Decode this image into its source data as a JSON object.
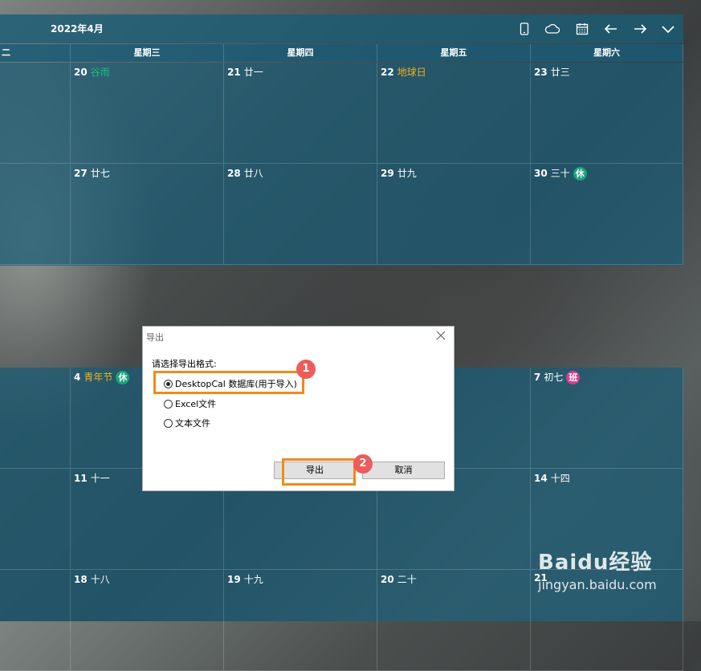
{
  "header": {
    "title": "2022年4月"
  },
  "weekdays": [
    "二",
    "星期三",
    "星期四",
    "星期五",
    "星期六"
  ],
  "top_rows": [
    [
      {
        "day": "",
        "lunar": "",
        "lunar_color": ""
      },
      {
        "day": "20",
        "lunar": "谷雨",
        "lunar_color": "green"
      },
      {
        "day": "21",
        "lunar": "廿一",
        "lunar_color": ""
      },
      {
        "day": "22",
        "lunar": "地球日",
        "lunar_color": "orange"
      },
      {
        "day": "23",
        "lunar": "廿三",
        "lunar_color": ""
      }
    ],
    [
      {
        "day": "",
        "lunar": "",
        "lunar_color": ""
      },
      {
        "day": "27",
        "lunar": "廿七",
        "lunar_color": ""
      },
      {
        "day": "28",
        "lunar": "廿八",
        "lunar_color": ""
      },
      {
        "day": "29",
        "lunar": "廿九",
        "lunar_color": ""
      },
      {
        "day": "30",
        "lunar": "三十",
        "lunar_color": "",
        "badge": "休",
        "badge_type": "rest"
      }
    ]
  ],
  "bottom_rows": [
    [
      {
        "day": "",
        "lunar": "",
        "lunar_color": ""
      },
      {
        "day": "4",
        "lunar": "青年节",
        "lunar_color": "orange",
        "badge": "休",
        "badge_type": "rest"
      },
      {
        "day": "",
        "lunar": "",
        "lunar_color": ""
      },
      {
        "day": "",
        "lunar": "",
        "lunar_color": ""
      },
      {
        "day": "7",
        "lunar": "初七",
        "lunar_color": "",
        "badge": "班",
        "badge_type": "work"
      }
    ],
    [
      {
        "day": "",
        "lunar": "",
        "lunar_color": ""
      },
      {
        "day": "11",
        "lunar": "十一",
        "lunar_color": ""
      },
      {
        "day": "",
        "lunar": "",
        "lunar_color": ""
      },
      {
        "day": "",
        "lunar": "",
        "lunar_color": ""
      },
      {
        "day": "14",
        "lunar": "十四",
        "lunar_color": ""
      }
    ],
    [
      {
        "day": "",
        "lunar": "",
        "lunar_color": ""
      },
      {
        "day": "18",
        "lunar": "十八",
        "lunar_color": ""
      },
      {
        "day": "19",
        "lunar": "十九",
        "lunar_color": ""
      },
      {
        "day": "20",
        "lunar": "二十",
        "lunar_color": ""
      },
      {
        "day": "21",
        "lunar": "",
        "lunar_color": ""
      }
    ]
  ],
  "dialog": {
    "title": "导出",
    "prompt": "请选择导出格式:",
    "options": [
      "DesktopCal 数据库(用于导入)",
      "Excel文件",
      "文本文件"
    ],
    "selected": 0,
    "export_label": "导出",
    "cancel_label": "取消"
  },
  "markers": [
    "1",
    "2"
  ],
  "watermark": {
    "brand": "Baidu经验",
    "url": "jingyan.baidu.com"
  },
  "colors": {
    "pane": "#195c76",
    "highlight": "#f08a1c",
    "marker": "#ee5b5b",
    "rest_badge": "#1aa37a",
    "work_badge": "#d63c8c"
  }
}
